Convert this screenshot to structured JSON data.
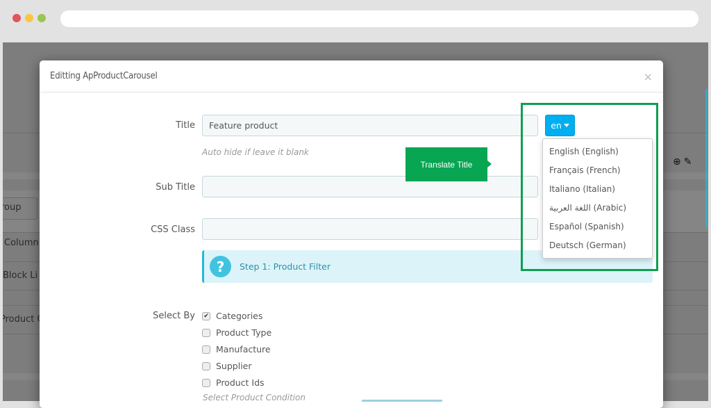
{
  "browser": {
    "traffic_lights": [
      "close",
      "minimize",
      "maximize"
    ],
    "colors": {
      "red": "#e0555d",
      "yellow": "#f7c844",
      "green": "#98c653"
    }
  },
  "background_page": {
    "fragments": [
      "roup",
      "Column",
      "Block Li",
      "Product C"
    ],
    "icons": [
      "plus-circle-icon",
      "pencil-icon"
    ]
  },
  "modal": {
    "title": "Editting ApProductCarousel",
    "close_label": "×",
    "fields": {
      "title": {
        "label": "Title",
        "value": "Feature product",
        "help": "Auto hide if leave it blank"
      },
      "sub_title": {
        "label": "Sub Title",
        "value": ""
      },
      "css_class": {
        "label": "CSS Class",
        "value": ""
      }
    },
    "language": {
      "selected": "en",
      "options": [
        "English (English)",
        "Français (French)",
        "Italiano (Italian)",
        "اللغة العربية (Arabic)",
        "Español (Spanish)",
        "Deutsch (German)"
      ]
    },
    "tooltip": "Translate Title",
    "alert": {
      "icon": "?",
      "text": "Step 1: Product Filter"
    },
    "select_by": {
      "label": "Select By",
      "options": [
        {
          "label": "Categories",
          "checked": true
        },
        {
          "label": "Product Type",
          "checked": false
        },
        {
          "label": "Manufacture",
          "checked": false
        },
        {
          "label": "Supplier",
          "checked": false
        },
        {
          "label": "Product Ids",
          "checked": false
        }
      ],
      "condition_label": "Select Product Condition"
    }
  },
  "colors": {
    "accent_blue": "#00aff0",
    "highlight_green": "#0d9f4f",
    "tooltip_green": "#08a553",
    "alert_bg": "#dcf4f9",
    "alert_border": "#25b9d7"
  }
}
